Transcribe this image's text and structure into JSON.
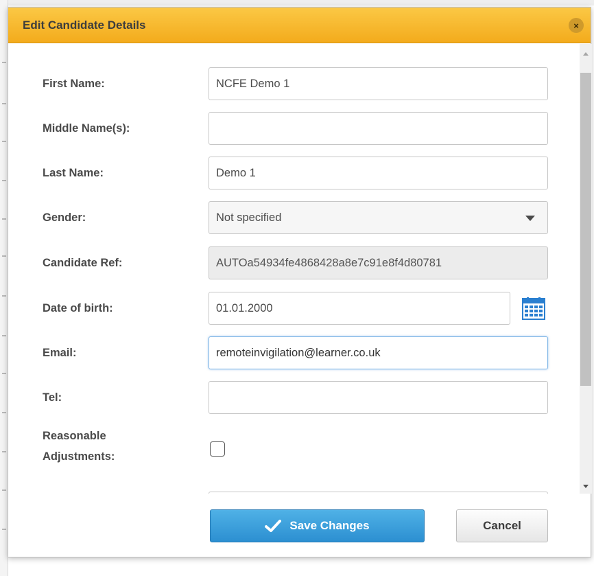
{
  "dialog": {
    "title": "Edit Candidate Details",
    "close_label": "×"
  },
  "form": {
    "first_name": {
      "label": "First Name:",
      "value": "NCFE Demo 1"
    },
    "middle_name": {
      "label": "Middle Name(s):",
      "value": ""
    },
    "last_name": {
      "label": "Last Name:",
      "value": "Demo 1"
    },
    "gender": {
      "label": "Gender:",
      "selected": "Not specified"
    },
    "candidate_ref": {
      "label": "Candidate Ref:",
      "value": "AUTOa54934fe4868428a8e7c91e8f4d80781"
    },
    "dob": {
      "label": "Date of birth:",
      "value": "01.01.2000"
    },
    "email": {
      "label": "Email:",
      "value": "remoteinvigilation@learner.co.uk"
    },
    "tel": {
      "label": "Tel:",
      "value": ""
    },
    "reasonable_adjustments": {
      "label_line1": "Reasonable",
      "label_line2": "Adjustments:",
      "checked": false
    }
  },
  "buttons": {
    "save_label": "Save Changes",
    "cancel_label": "Cancel"
  },
  "colors": {
    "title_bar": "#f5b126",
    "save_button": "#3a9edb",
    "focus_border": "#7fb5e6",
    "calendar_icon": "#2a7fd0"
  },
  "icons": {
    "close": "close-icon",
    "calendar": "calendar-icon",
    "check": "checkmark-icon",
    "dropdown": "chevron-down-icon"
  }
}
